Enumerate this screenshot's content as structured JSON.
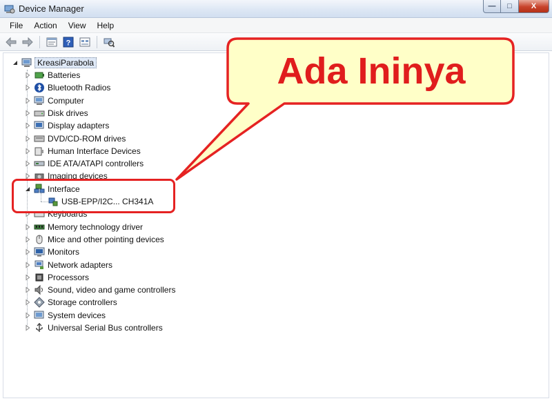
{
  "window": {
    "title": "Device Manager",
    "controls": {
      "minimize": "—",
      "maximize": "□",
      "close": "X"
    }
  },
  "menu": [
    "File",
    "Action",
    "View",
    "Help"
  ],
  "toolbar": {
    "icons": [
      "back-arrow-icon",
      "forward-arrow-icon",
      "properties-icon",
      "help-icon",
      "view-icon",
      "scan-hardware-icon"
    ]
  },
  "tree": {
    "root": "KreasiParabola",
    "categories": [
      {
        "label": "Batteries",
        "icon": "battery-icon"
      },
      {
        "label": "Bluetooth Radios",
        "icon": "bluetooth-icon"
      },
      {
        "label": "Computer",
        "icon": "computer-icon"
      },
      {
        "label": "Disk drives",
        "icon": "disk-drive-icon"
      },
      {
        "label": "Display adapters",
        "icon": "display-adapter-icon"
      },
      {
        "label": "DVD/CD-ROM drives",
        "icon": "dvd-drive-icon"
      },
      {
        "label": "Human Interface Devices",
        "icon": "hid-icon"
      },
      {
        "label": "IDE ATA/ATAPI controllers",
        "icon": "ide-controller-icon"
      },
      {
        "label": "Imaging devices",
        "icon": "imaging-device-icon"
      },
      {
        "label": "Interface",
        "icon": "network-interface-icon",
        "expanded": true,
        "children": [
          {
            "label": "USB-EPP/I2C... CH341A",
            "icon": "usb-device-icon"
          }
        ]
      },
      {
        "label": "Keyboards",
        "icon": "keyboard-icon"
      },
      {
        "label": "Memory technology driver",
        "icon": "memory-icon"
      },
      {
        "label": "Mice and other pointing devices",
        "icon": "mouse-icon"
      },
      {
        "label": "Monitors",
        "icon": "monitor-icon"
      },
      {
        "label": "Network adapters",
        "icon": "network-adapter-icon"
      },
      {
        "label": "Processors",
        "icon": "processor-icon"
      },
      {
        "label": "Sound, video and game controllers",
        "icon": "sound-icon"
      },
      {
        "label": "Storage controllers",
        "icon": "storage-controller-icon"
      },
      {
        "label": "System devices",
        "icon": "system-device-icon"
      },
      {
        "label": "Universal Serial Bus controllers",
        "icon": "usb-controller-icon"
      }
    ]
  },
  "callout": {
    "text": "Ada Ininya",
    "border_color": "#e52222",
    "fill_color": "#ffffc8",
    "text_color": "#e01d1d"
  }
}
